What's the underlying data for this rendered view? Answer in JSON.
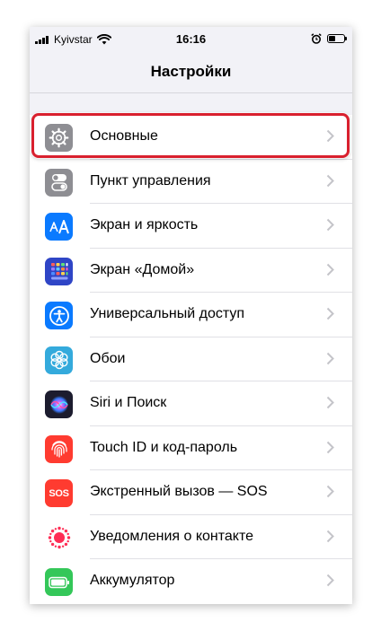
{
  "status_bar": {
    "carrier": "Kyivstar",
    "time": "16:16"
  },
  "nav": {
    "title": "Настройки"
  },
  "settings": [
    {
      "label": "Основные",
      "icon": "gear-icon",
      "color": "#8e8e93"
    },
    {
      "label": "Пункт управления",
      "icon": "toggles-icon",
      "color": "#8e8e93"
    },
    {
      "label": "Экран и яркость",
      "icon": "text-size-icon",
      "color": "#0a7aff"
    },
    {
      "label": "Экран «Домой»",
      "icon": "home-grid-icon",
      "color": "#2f45c6"
    },
    {
      "label": "Универсальный доступ",
      "icon": "accessibility-icon",
      "color": "#0a7aff"
    },
    {
      "label": "Обои",
      "icon": "wallpaper-flower-icon",
      "color": "#34aadc"
    },
    {
      "label": "Siri и Поиск",
      "icon": "siri-icon",
      "color": "#1c1c2e"
    },
    {
      "label": "Touch ID и код-пароль",
      "icon": "fingerprint-icon",
      "color": "#ff3b30"
    },
    {
      "label": "Экстренный вызов — SOS",
      "icon": "sos-icon",
      "color": "#ff3b30",
      "icon_text": "SOS"
    },
    {
      "label": "Уведомления о контакте",
      "icon": "exposure-notification-icon",
      "color": "#ffffff"
    },
    {
      "label": "Аккумулятор",
      "icon": "battery-icon",
      "color": "#34c759"
    }
  ]
}
